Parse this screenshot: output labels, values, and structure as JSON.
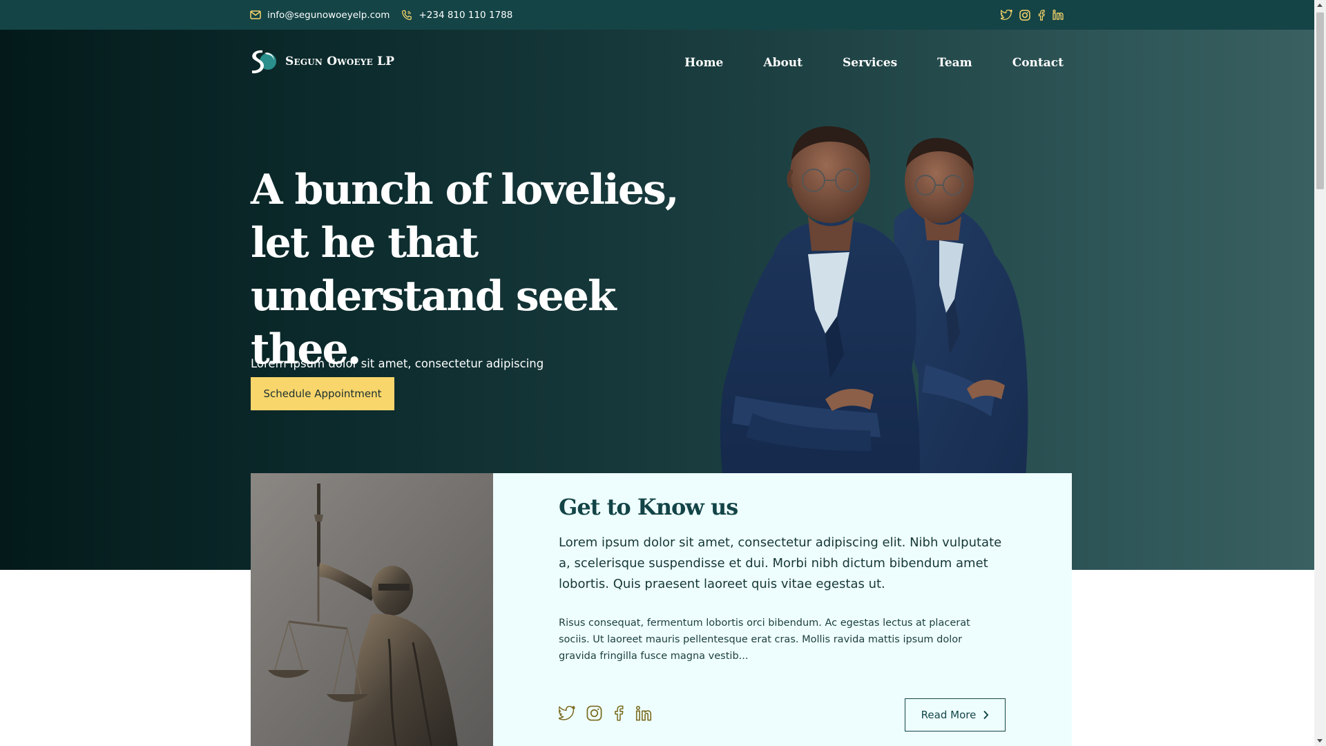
{
  "topbar": {
    "email": "info@segunowoeyelp.com",
    "phone": "+234 810 110 1788",
    "social_icons": [
      "twitter-icon",
      "instagram-icon",
      "facebook-icon",
      "linkedin-icon"
    ]
  },
  "brand": {
    "name": "Segun Owoeye LP"
  },
  "nav": {
    "items": [
      "Home",
      "About",
      "Services",
      "Team",
      "Contact"
    ]
  },
  "hero": {
    "title": "A bunch of lovelies, let he that understand seek thee.",
    "subtitle": "Lorem ipsum dolor sit amet, consectetur adipiscing elit. Sollicitudin cum",
    "cta_label": "Schedule Appointment"
  },
  "about": {
    "title": "Get to Know us",
    "lead": "Lorem ipsum dolor sit amet, consectetur adipiscing elit. Nibh vulputate a, scelerisque suspendisse et dui. Morbi nibh dictum bibendum amet lobortis. Quis praesent laoreet quis vitae egestas ut.",
    "body": "Risus consequat, fermentum lobortis orci bibendum. Ac egestas lectus at placerat sociis. Ut laoreet mauris pellentesque erat cras. Mollis ravida mattis ipsum dolor gravida fringilla fusce magna vestib...",
    "read_more_label": "Read More",
    "social_icons": [
      "twitter-icon",
      "instagram-icon",
      "facebook-icon",
      "linkedin-icon"
    ]
  },
  "colors": {
    "topbar": "#144446",
    "accent": "#f9d66b",
    "brand_dark": "#134447",
    "card_bg": "#eefefe"
  }
}
